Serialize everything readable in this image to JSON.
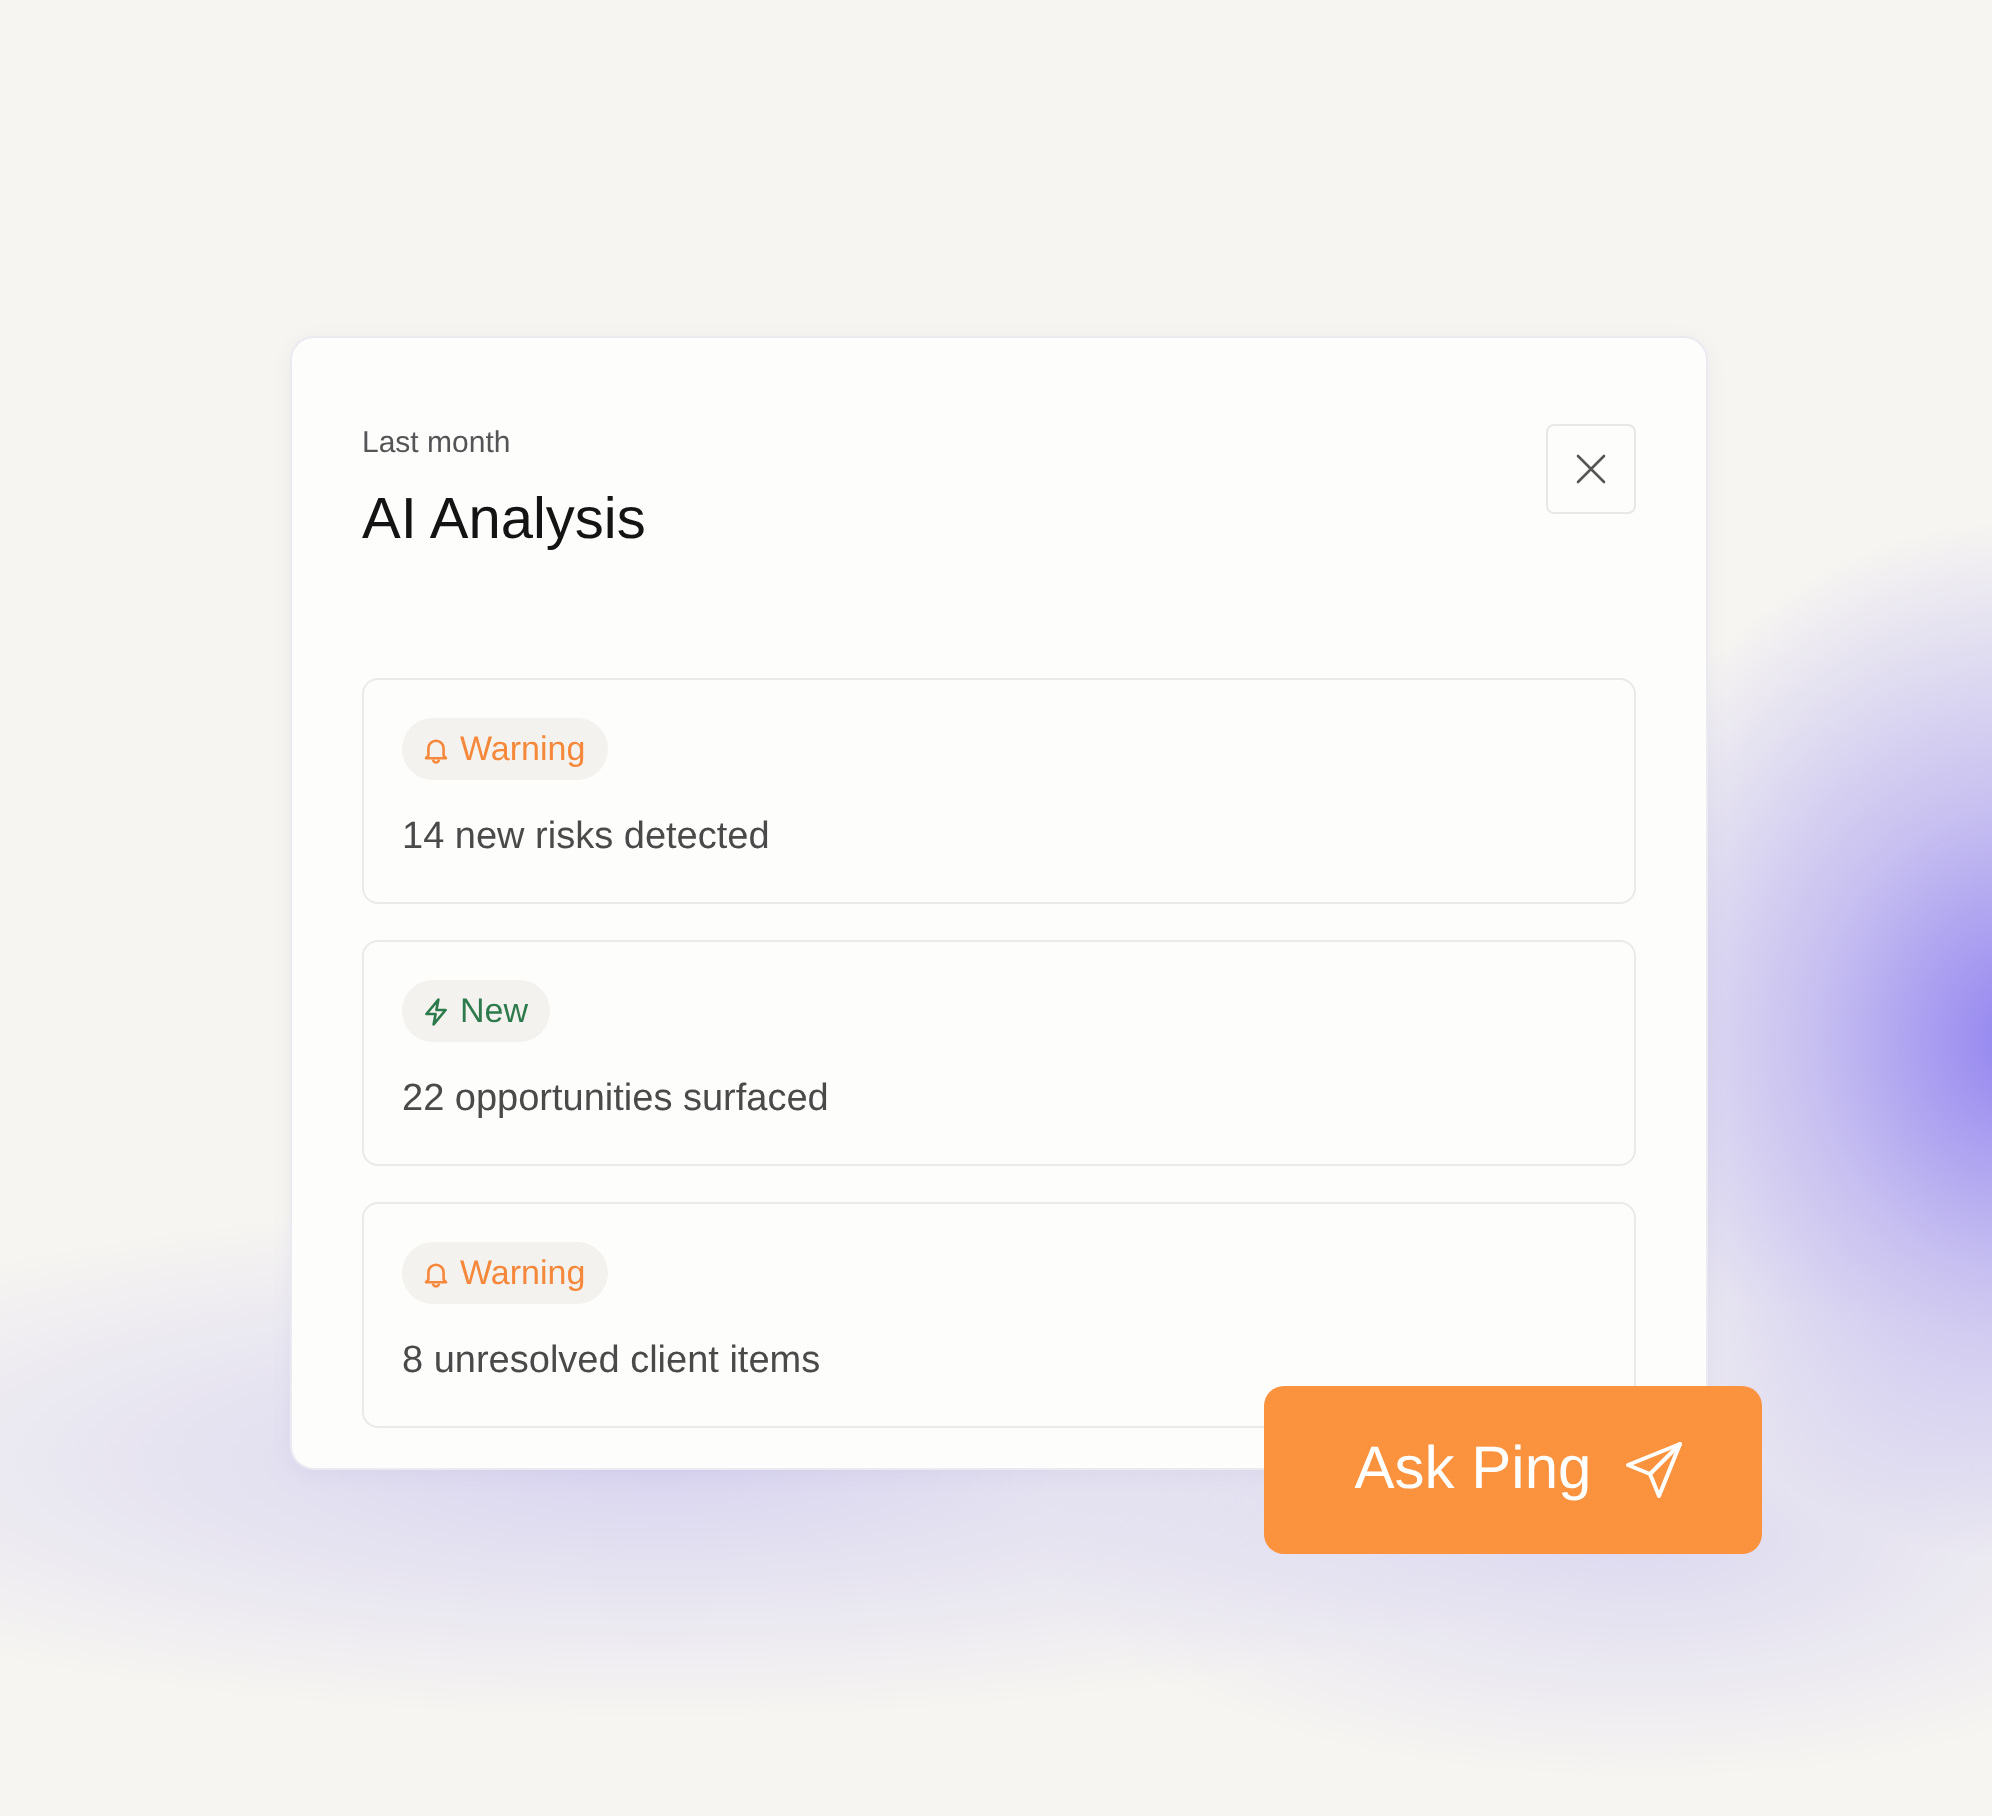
{
  "header": {
    "subtitle": "Last month",
    "title": "AI Analysis"
  },
  "insights": [
    {
      "badge": {
        "kind": "warning",
        "label": "Warning"
      },
      "text": "14 new risks detected"
    },
    {
      "badge": {
        "kind": "new",
        "label": "New"
      },
      "text": "22 opportunities surfaced"
    },
    {
      "badge": {
        "kind": "warning",
        "label": "Warning"
      },
      "text": "8 unresolved client items"
    }
  ],
  "action_button": {
    "label": "Ask Ping"
  }
}
